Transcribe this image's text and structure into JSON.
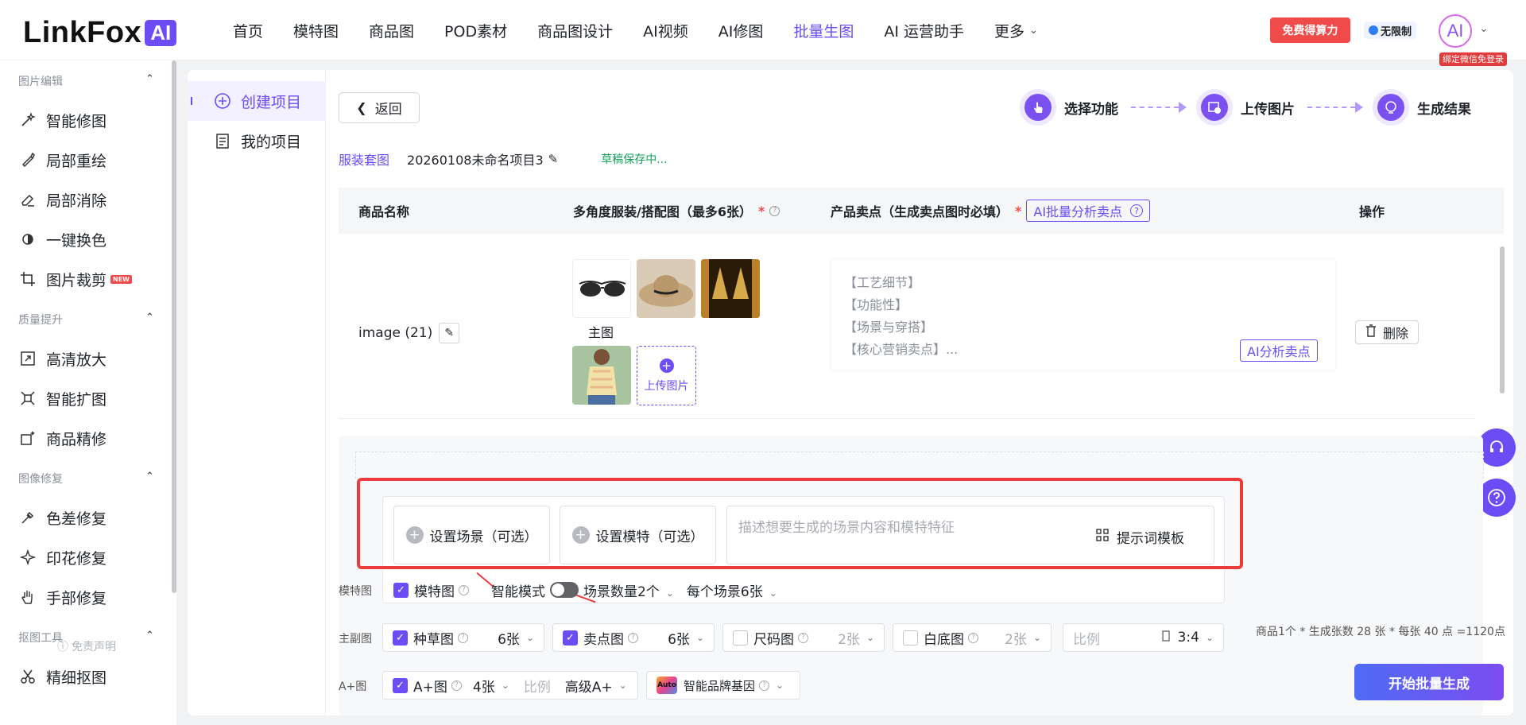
{
  "header": {
    "logo_text": "LinkFox",
    "logo_ai": "AI",
    "nav": [
      {
        "label": "首页"
      },
      {
        "label": "模特图"
      },
      {
        "label": "商品图"
      },
      {
        "label": "POD素材"
      },
      {
        "label": "商品图设计"
      },
      {
        "label": "AI视频"
      },
      {
        "label": "AI修图"
      },
      {
        "label": "批量生图"
      },
      {
        "label": "AI 运营助手"
      },
      {
        "label": "更多"
      }
    ],
    "active_nav": "批量生图",
    "free_btn": "免费得算力",
    "unlimited": "无限制",
    "avatar_text": "AI",
    "bind_tip": "绑定微信免登录"
  },
  "sidebar": {
    "groups": [
      {
        "title": "图片编辑",
        "items": [
          "智能修图",
          "局部重绘",
          "局部消除",
          "一键换色",
          "图片裁剪"
        ]
      },
      {
        "title": "质量提升",
        "items": [
          "高清放大",
          "智能扩图",
          "商品精修"
        ]
      },
      {
        "title": "图像修复",
        "items": [
          "色差修复",
          "印花修复",
          "手部修复"
        ]
      },
      {
        "title": "抠图工具",
        "items": [
          "精细抠图"
        ]
      }
    ],
    "new_tag": "NEW",
    "footer": "免责声明"
  },
  "subnav": {
    "create": "创建项目",
    "mine": "我的项目"
  },
  "toolbar": {
    "back": "返回"
  },
  "steps": [
    {
      "label": "选择功能"
    },
    {
      "label": "上传图片"
    },
    {
      "label": "生成结果"
    }
  ],
  "breadcrumb": {
    "link": "服装套图",
    "project": "20260108未命名项目3",
    "draft": "草稿保存中..."
  },
  "table": {
    "headers": {
      "name": "商品名称",
      "images": "多角度服装/搭配图（最多6张）",
      "selling": "产品卖点（生成卖点图时必填）",
      "ai_batch": "AI批量分析卖点",
      "ops": "操作"
    },
    "row": {
      "name": "image (21)",
      "main_label": "主图",
      "upload": "上传图片",
      "selling_points": [
        "【工艺细节】",
        "【功能性】",
        "【场景与穿搭】",
        "【核心营销卖点】..."
      ],
      "ai_analyze": "AI分析卖点",
      "delete": "删除"
    }
  },
  "config": {
    "set_scene": "设置场景（可选）",
    "set_model": "设置模特（可选）",
    "prompt_placeholder": "描述想要生成的场景内容和模特特征",
    "prompt_template": "提示词模板",
    "model_row_label": "模特图",
    "model_img": "模特图",
    "smart_mode": "智能模式",
    "scene_count": "场景数量2个",
    "per_scene": "每个场景6张",
    "main_row_label": "主副图",
    "seed": {
      "label": "种草图",
      "count": "6张"
    },
    "selling": {
      "label": "卖点图",
      "count": "6张"
    },
    "size": {
      "label": "尺码图",
      "count": "2张"
    },
    "white": {
      "label": "白底图",
      "count": "2张"
    },
    "ratio_label": "比例",
    "ratio_value": "3:4",
    "aplus_row_label": "A+图",
    "aplus": {
      "label": "A+图",
      "count": "4张"
    },
    "aplus_ratio_label": "比例",
    "aplus_level": "高级A+",
    "auto_badge": "Auto",
    "brand_gene": "智能品牌基因"
  },
  "calc_text": "商品1个 * 生成张数 28 张 * 每张 40 点 =1120点",
  "generate_btn": "开始批量生成",
  "colors": {
    "accent": "#6c4cf5",
    "danger": "#f04a4a",
    "highlight_frame": "#ec3b3b"
  }
}
